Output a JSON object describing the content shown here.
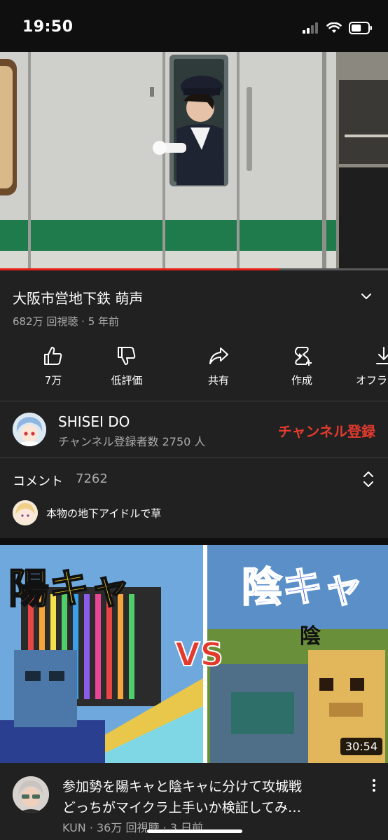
{
  "status_bar": {
    "time": "19:50",
    "battery_level": 0.6
  },
  "player": {
    "progress_fraction": 0.72
  },
  "video": {
    "title": "大阪市営地下鉄 萌声",
    "meta": "682万 回視聴 · 5 年前"
  },
  "actions": [
    {
      "label": "7万",
      "icon": "thumbs-up-icon"
    },
    {
      "label": "低評価",
      "icon": "thumbs-down-icon"
    },
    {
      "label": "共有",
      "icon": "share-icon"
    },
    {
      "label": "作成",
      "icon": "create-icon"
    },
    {
      "label": "オフラ",
      "icon": "download-icon"
    }
  ],
  "channel": {
    "name": "SHISEI DO",
    "subscribers": "チャンネル登録者数 2750 人",
    "subscribe_label": "チャンネル登録"
  },
  "comments": {
    "heading": "コメント",
    "count": "7262",
    "top_comment": "本物の地下アイドルで草"
  },
  "next_video": {
    "thumb_left_text": "陽キャ",
    "thumb_vs": "VS",
    "thumb_right_text": "陰キャ",
    "thumb_small_text": "陰",
    "duration": "30:54",
    "title_line1": "参加勢を陽キャと陰キャに分けて攻城戦",
    "title_line2": "どっちがマイクラ上手いか検証してみ…",
    "meta": "KUN · 36万 回視聴 · 3 日前"
  },
  "colors": {
    "background": "#212121",
    "subscribe": "#e23b2e",
    "progress": "#e62117",
    "secondary_text": "#aaaaaa"
  }
}
